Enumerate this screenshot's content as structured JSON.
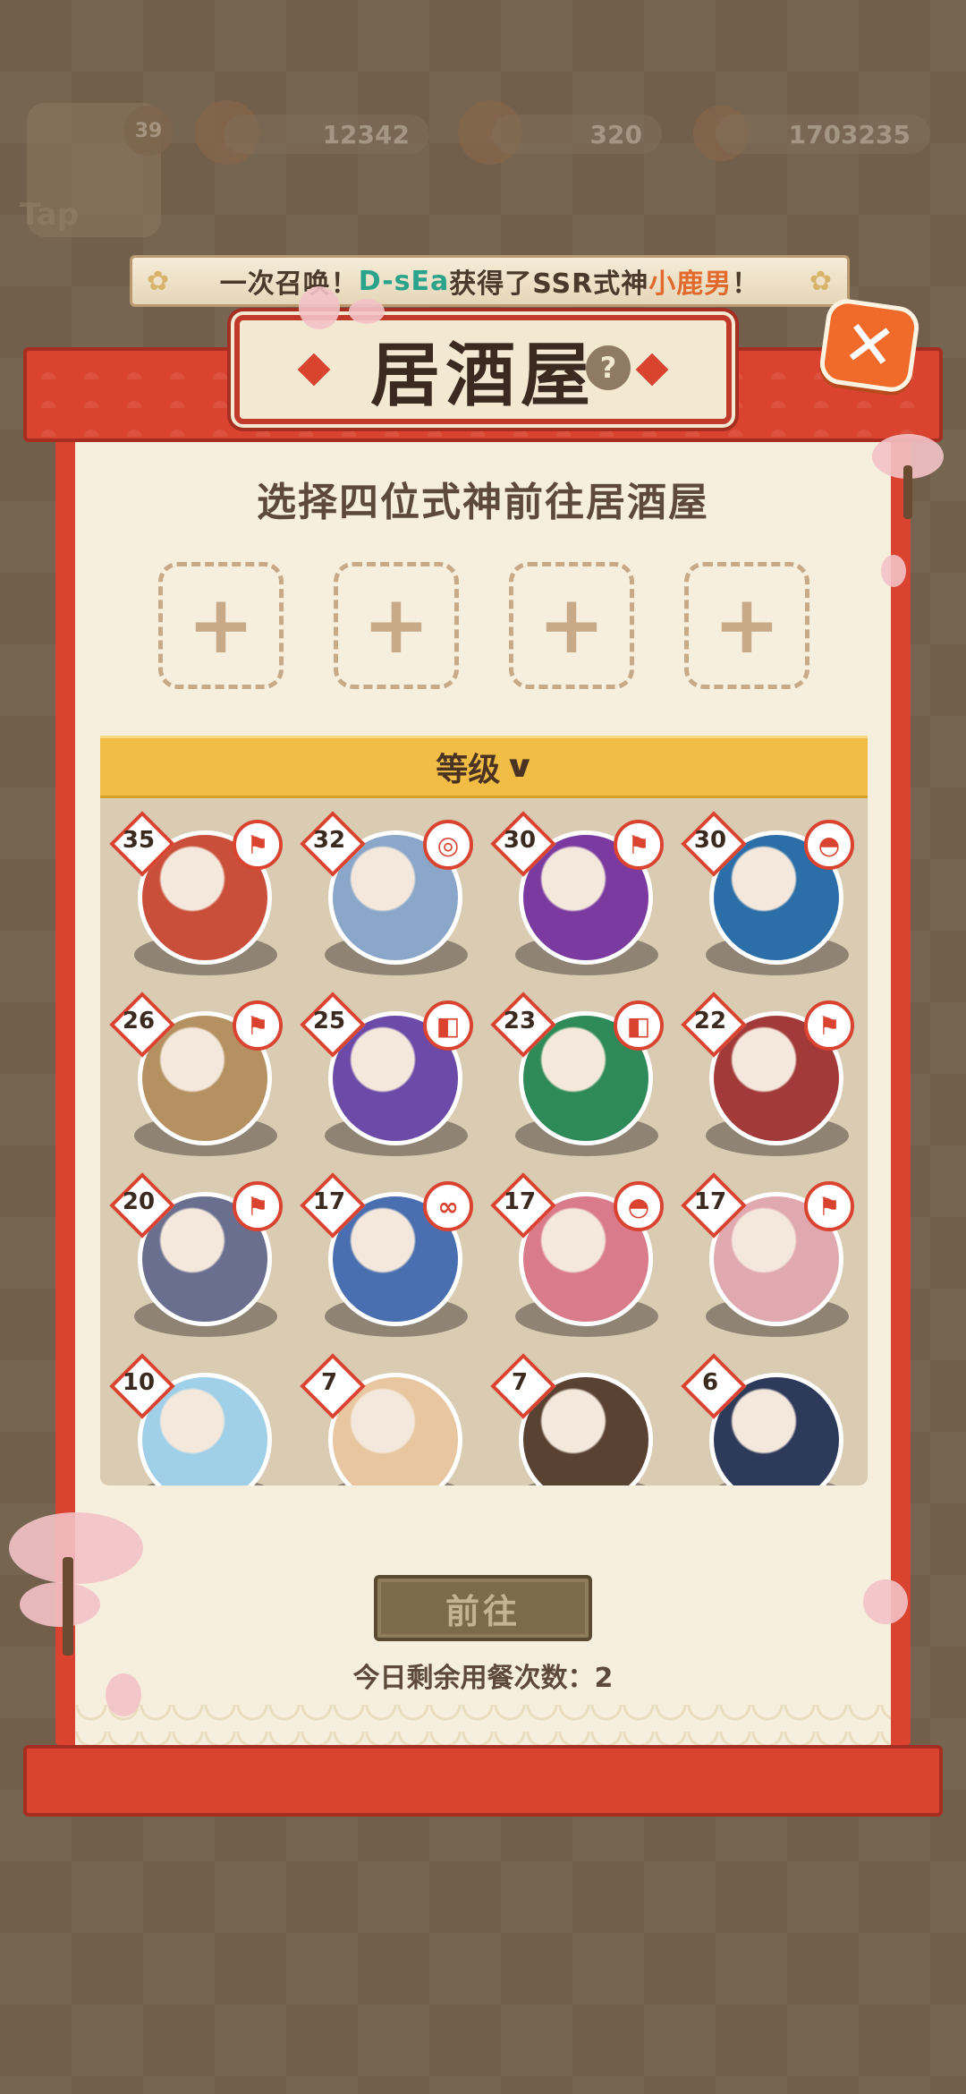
{
  "hud": {
    "player_level": "39",
    "tap_label": "Tap",
    "resources": [
      {
        "icon": "fortune-bag-icon",
        "value": "12342"
      },
      {
        "icon": "food-bowl-icon",
        "value": "320"
      },
      {
        "icon": "coin-icon",
        "value": "1703235"
      }
    ]
  },
  "banner": {
    "prefix": "一次召唤！",
    "player": "D-sEa",
    "middle": "获得了SSR式神",
    "shikigami": "小鹿男",
    "suffix": "！"
  },
  "panel": {
    "title": "居酒屋",
    "help_label": "?",
    "close_label": "✕",
    "subtitle": "选择四位式神前往居酒屋",
    "slot_label": "+",
    "sort_label": "等级",
    "go_label": "前往",
    "remaining_label": "今日剩余用餐次数：2"
  },
  "shikigami": [
    {
      "level": "35",
      "type_icon": "attack-icon",
      "color": "#c94f3a"
    },
    {
      "level": "32",
      "type_icon": "control-icon",
      "color": "#8aa7c9"
    },
    {
      "level": "30",
      "type_icon": "attack-icon",
      "color": "#7a3aa0"
    },
    {
      "level": "30",
      "type_icon": "support-icon",
      "color": "#2c6fa8"
    },
    {
      "level": "26",
      "type_icon": "attack-icon",
      "color": "#b59060"
    },
    {
      "level": "25",
      "type_icon": "defense-icon",
      "color": "#6b4aa8"
    },
    {
      "level": "23",
      "type_icon": "defense-icon",
      "color": "#2f8a5a"
    },
    {
      "level": "22",
      "type_icon": "attack-icon",
      "color": "#a33a3a"
    },
    {
      "level": "20",
      "type_icon": "attack-icon",
      "color": "#6a6f8f"
    },
    {
      "level": "17",
      "type_icon": "heal-icon",
      "color": "#4a6fb0"
    },
    {
      "level": "17",
      "type_icon": "support-icon",
      "color": "#d97b8a"
    },
    {
      "level": "17",
      "type_icon": "attack-icon",
      "color": "#e0a9b0"
    },
    {
      "level": "10",
      "type_icon": "",
      "color": "#9fd0e8"
    },
    {
      "level": "7",
      "type_icon": "",
      "color": "#e8c7a0"
    },
    {
      "level": "7",
      "type_icon": "",
      "color": "#5a4232"
    },
    {
      "level": "6",
      "type_icon": "",
      "color": "#2e3a5a"
    }
  ]
}
